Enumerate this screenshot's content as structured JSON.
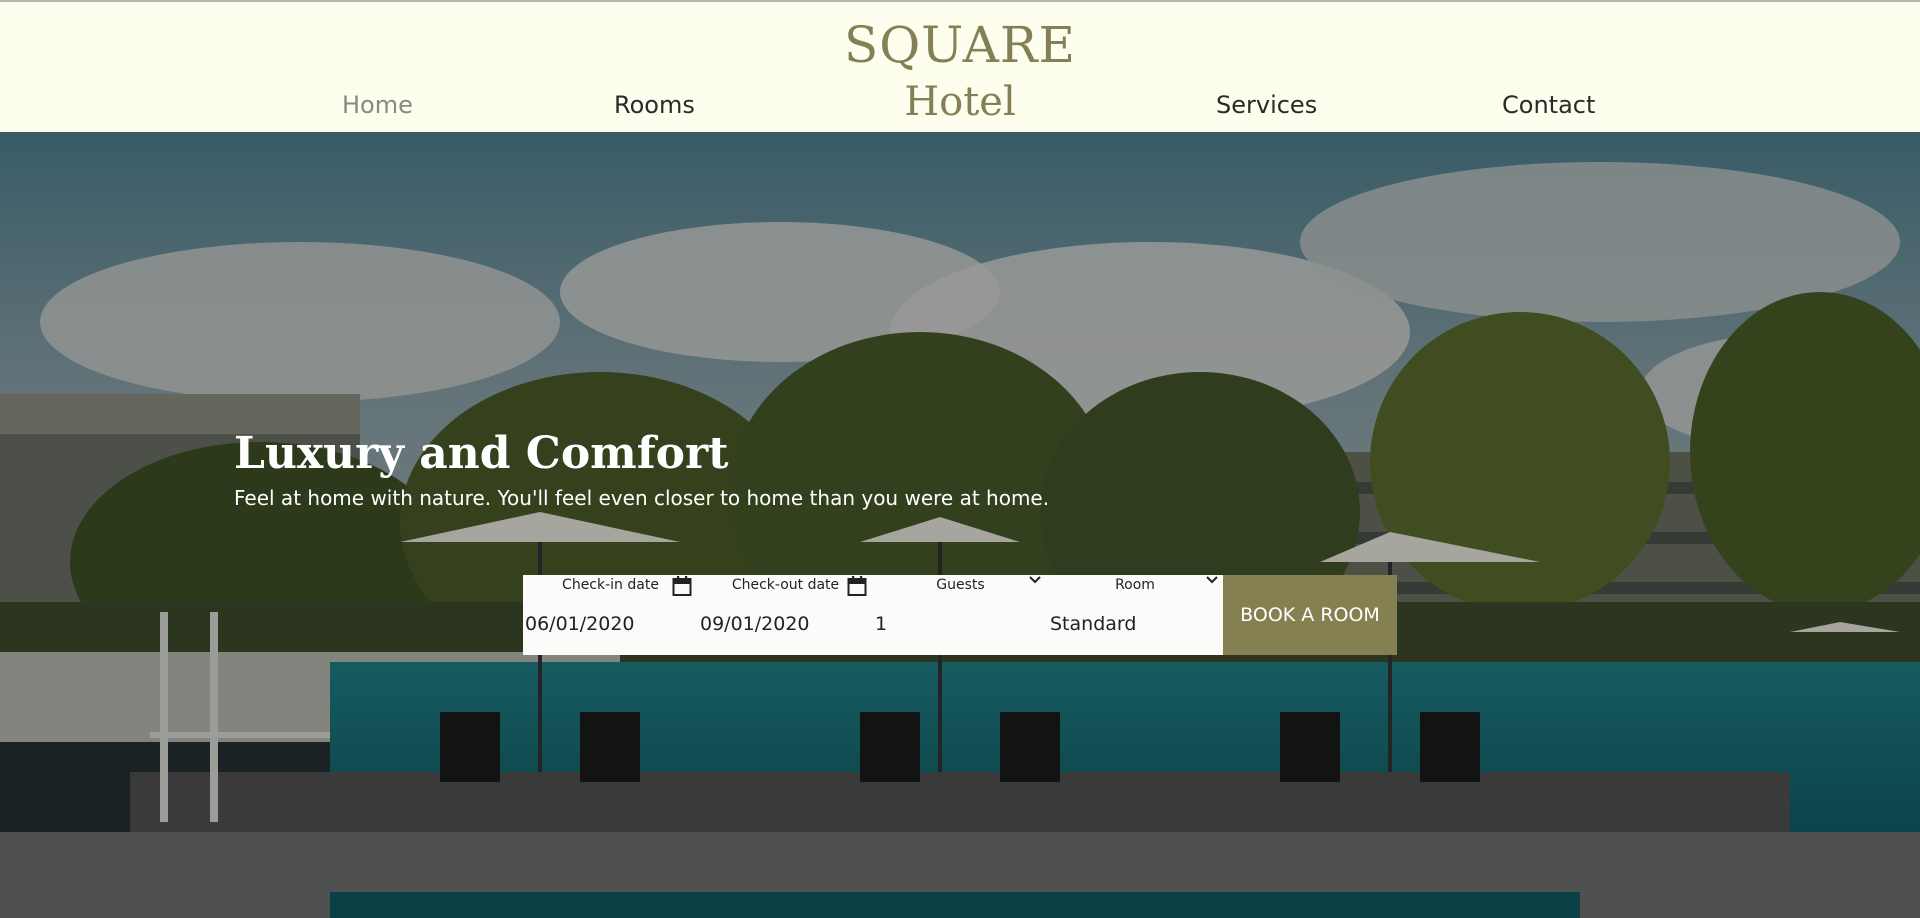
{
  "brand": {
    "line1": "SQUARE",
    "line2": "Hotel"
  },
  "nav": {
    "home": "Home",
    "rooms": "Rooms",
    "services": "Services",
    "contact": "Contact"
  },
  "hero": {
    "title": "Luxury and Comfort",
    "subtitle": "Feel at home with nature. You'll feel even closer to home than you were at home."
  },
  "booking": {
    "checkin": {
      "label": "Check-in date",
      "value": "06/01/2020",
      "icon": "calendar-icon"
    },
    "checkout": {
      "label": "Check-out date",
      "value": "09/01/2020",
      "icon": "calendar-icon"
    },
    "guests": {
      "label": "Guests",
      "value": "1",
      "icon": "chevron-down-icon"
    },
    "room": {
      "label": "Room",
      "value": "Standard",
      "icon": "chevron-down-icon"
    },
    "button": "BOOK A ROOM"
  },
  "colors": {
    "accent": "#858052",
    "header_bg": "#fefeef",
    "nav_active": "#8a8a7c"
  }
}
